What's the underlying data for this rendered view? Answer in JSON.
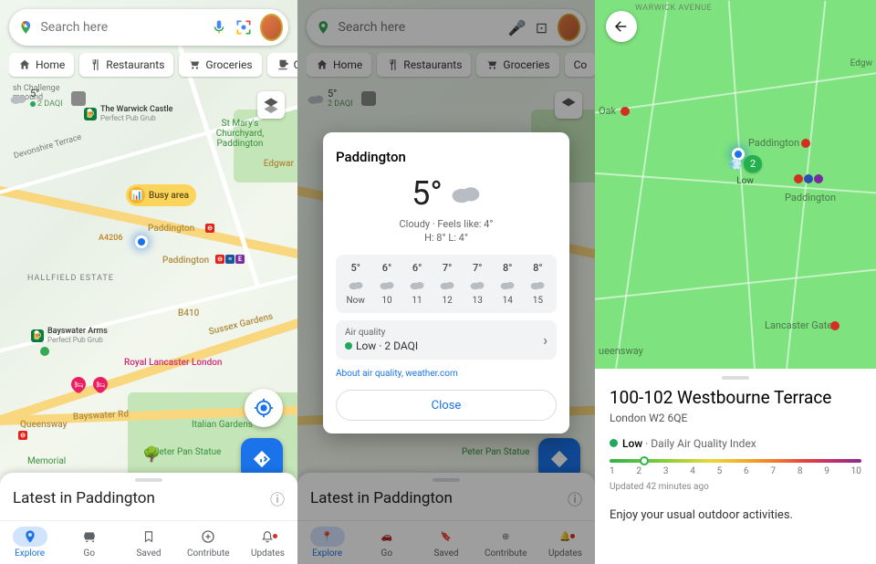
{
  "search": {
    "placeholder": "Search here"
  },
  "chips": {
    "home": "Home",
    "restaurants": "Restaurants",
    "groceries": "Groceries",
    "coffee": "Co"
  },
  "wxpill": {
    "temp": "5°",
    "aqi": "2 DAQI"
  },
  "busy": "Busy area",
  "map_labels": {
    "warwick": "The Warwick Castle",
    "warwick_sub": "Perfect Pub Grub",
    "stmary": "St Mary's Churchyard, Paddington",
    "edgware": "Edgwar",
    "paddington1": "Paddington",
    "a4206": "A4206",
    "paddington2": "Paddington",
    "hallfield": "HALLFIELD ESTATE",
    "b410": "B410",
    "sussex": "Sussex Gardens",
    "bayswater": "Bayswater Arms",
    "bayswater_sub": "Perfect Pub Grub",
    "lancaster": "Royal Lancaster London",
    "bayswater_rd": "Bayswater Rd",
    "queensway": "Queensway",
    "italian": "Italian Gardens",
    "panstatue": "Peter Pan Statue",
    "memorial": "Memorial",
    "devonshire": "Devonshire Terrace"
  },
  "latest": "Latest in Paddington",
  "nav": {
    "explore": "Explore",
    "go": "Go",
    "saved": "Saved",
    "contribute": "Contribute",
    "updates": "Updates"
  },
  "wx": {
    "place": "Paddington",
    "temp": "5°",
    "desc": "Cloudy · Feels like: 4°",
    "hl": "H: 8° L: 4°",
    "hours": [
      {
        "t": "5°",
        "l": "Now"
      },
      {
        "t": "6°",
        "l": "10"
      },
      {
        "t": "6°",
        "l": "11"
      },
      {
        "t": "7°",
        "l": "12"
      },
      {
        "t": "7°",
        "l": "13"
      },
      {
        "t": "8°",
        "l": "14"
      },
      {
        "t": "8°",
        "l": "15"
      }
    ],
    "aq_title": "Air quality",
    "aq_value": "Low · 2 DAQI",
    "link1": "About air quality,",
    "link2": "weather.com",
    "close": "Close"
  },
  "p3": {
    "warwick_ave": "WARWICK AVENUE",
    "edgware": "Edgw",
    "oak": "Oak",
    "paddington_h": "Paddington",
    "paddington_l": "Paddington",
    "lanc": "Lancaster Gate",
    "queensway": "ueensway",
    "aqi_badge": "2",
    "aqi_low": "Low",
    "title": "100-102 Westbourne Terrace",
    "addr": "London W2 6QE",
    "low": "Low",
    "daqi": " · Daily Air Quality Index",
    "nums": [
      "1",
      "2",
      "3",
      "4",
      "5",
      "6",
      "7",
      "8",
      "9",
      "10"
    ],
    "updated": "Updated 42 minutes ago",
    "advice": "Enjoy your usual outdoor activities."
  }
}
